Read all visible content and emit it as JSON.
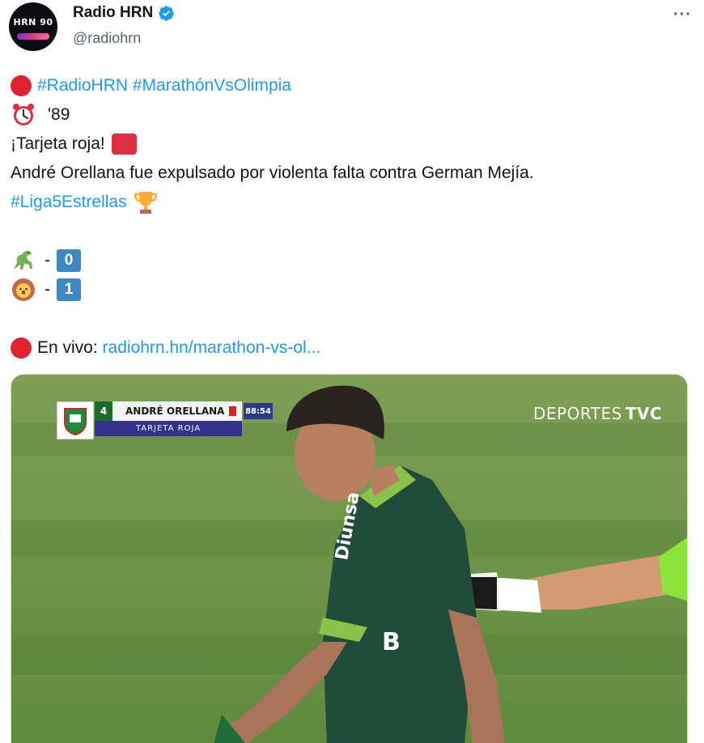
{
  "account": {
    "display_name": "Radio HRN",
    "handle": "@radiohrn",
    "avatar_text": "HRN 90",
    "verified": true
  },
  "menu": {
    "more_label": "···"
  },
  "tweet": {
    "hashtags_line": "#RadioHRN #MarathónVsOlimpia",
    "minute": "'89",
    "red_card_text": "¡Tarjeta roja!",
    "description": "André Orellana fue expulsado por violenta falta contra German Mejía.",
    "league_hashtag": "#Liga5Estrellas",
    "score": [
      {
        "team_emoji": "dinosaur-icon",
        "separator": "-",
        "goals": "0"
      },
      {
        "team_emoji": "lion-icon",
        "separator": "-",
        "goals": "1"
      }
    ],
    "live_label": "En vivo: ",
    "live_link": "radiohrn.hn/marathon-vs-ol..."
  },
  "media": {
    "scorebug": {
      "number": "4",
      "player": "ANDRÉ ORELLANA",
      "time": "88:54",
      "event": "TARJETA ROJA"
    },
    "broadcaster": "DEPORTES",
    "broadcaster_bold": "TVC",
    "jersey_text": "Diunsa"
  },
  "colors": {
    "link": "#1d9bf0",
    "verified": "#1d9bf0",
    "red_card": "#dd2e44",
    "text": "#0f1419",
    "secondary": "#536471"
  }
}
